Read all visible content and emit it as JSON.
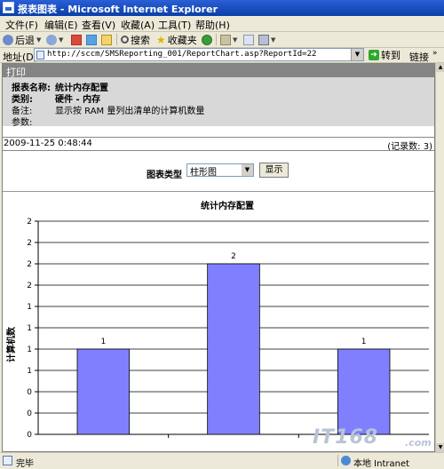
{
  "window": {
    "title": "报表图表 - Microsoft Internet Explorer"
  },
  "menu": [
    "文件(F)",
    "编辑(E)",
    "查看(V)",
    "收藏(A)",
    "工具(T)",
    "帮助(H)"
  ],
  "toolbar": {
    "back": "后退",
    "search": "搜索",
    "favorites": "收藏夹"
  },
  "address": {
    "label": "地址(D)",
    "url": "http://sccm/SMSReporting_001/ReportChart.asp?ReportId=22",
    "go": "转到",
    "links": "链接"
  },
  "report": {
    "print": "打印",
    "name_label": "报表名称:",
    "name": "统计内存配置",
    "category_label": "类别:",
    "category": "硬件 - 内存",
    "remark_label": "备注:",
    "remark": "显示按 RAM 量列出清单的计算机数量",
    "params_label": "参数:",
    "date": "2009-11-25 0:48:44",
    "record_count": "(记录数: 3)"
  },
  "controls": {
    "chart_type_label": "图表类型",
    "chart_type_value": "柱形图",
    "show_button": "显示"
  },
  "chart_data": {
    "type": "bar",
    "title": "统计内存配置",
    "ylabel": "计算机数",
    "categories": [
      "",
      "",
      ""
    ],
    "values": [
      1,
      2,
      1
    ],
    "data_labels": [
      "1",
      "2",
      "1"
    ],
    "y_tick_labels": [
      "0",
      "0",
      "0",
      "1",
      "1",
      "1",
      "1",
      "2",
      "2",
      "2",
      "2"
    ],
    "ylim": [
      0,
      2.5
    ],
    "bar_color": "#8080ff",
    "grid": true
  },
  "watermark": {
    "logo": "IT168",
    "domain": ".com"
  },
  "status": {
    "text": "完毕",
    "zone": "本地 Intranet"
  }
}
